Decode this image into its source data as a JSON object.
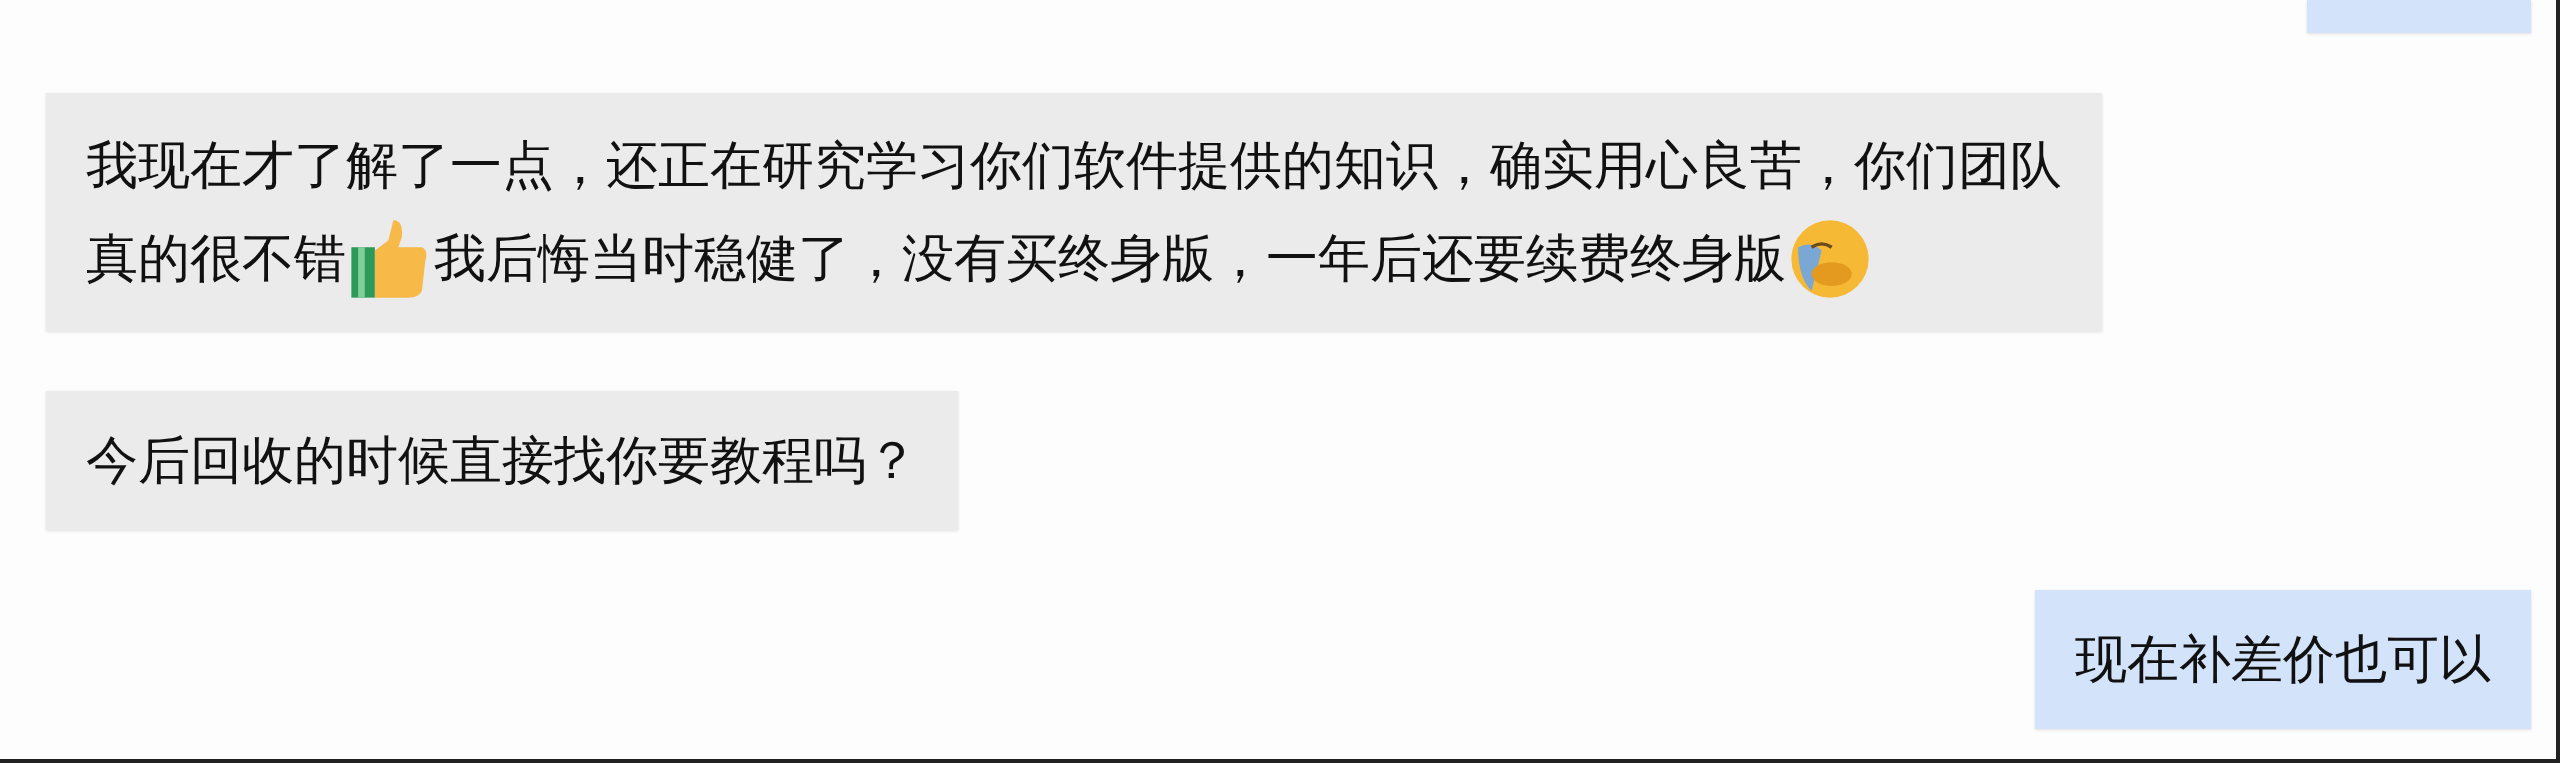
{
  "messages": [
    {
      "outgoing": true
    },
    {
      "outgoing": false,
      "lines": [
        [
          {
            "kind": "text",
            "text": "我现在才了解了一点，还正在研究学习你们软件提供的知识，确实用心良苦，你们团队"
          }
        ],
        [
          {
            "kind": "text",
            "text": "真的很不错"
          },
          {
            "kind": "thumbs-up"
          },
          {
            "kind": "text",
            "text": "我后悔当时稳健了，没有买终身版，一年后还要续费终身版"
          },
          {
            "kind": "crying-face"
          }
        ]
      ]
    },
    {
      "outgoing": false,
      "lines": [
        [
          {
            "kind": "text",
            "text": "今后回收的时候直接找你要教程吗？"
          }
        ]
      ]
    },
    {
      "outgoing": true,
      "lines": [
        [
          {
            "kind": "text",
            "text": "现在补差价也可以"
          }
        ]
      ]
    }
  ]
}
